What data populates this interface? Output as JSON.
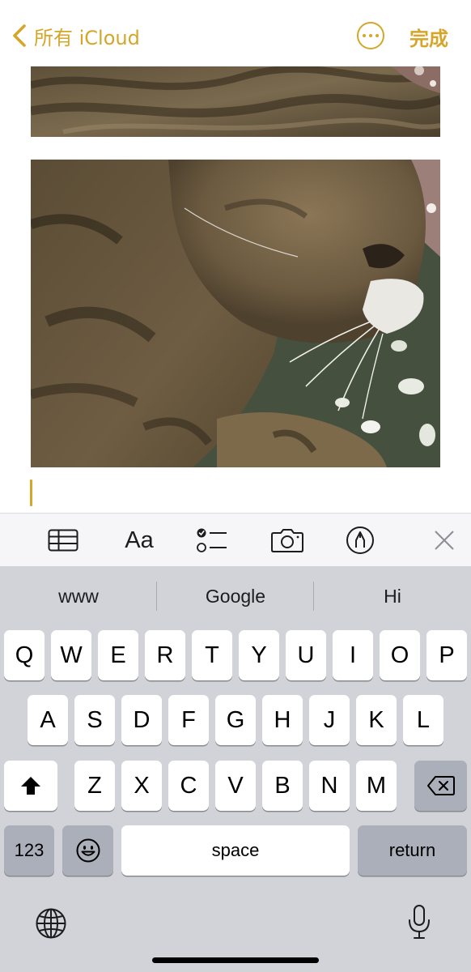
{
  "nav": {
    "back_label": "所有 iCloud",
    "done_label": "完成",
    "accent_color": "#d5a62a"
  },
  "toolbar": {
    "format_label": "Aa",
    "icons": [
      "table-icon",
      "text-format-icon",
      "checklist-icon",
      "camera-icon",
      "markup-pen-icon",
      "close-icon"
    ]
  },
  "keyboard": {
    "suggestions": [
      "www",
      "Google",
      "Hi"
    ],
    "row1": [
      "Q",
      "W",
      "E",
      "R",
      "T",
      "Y",
      "U",
      "I",
      "O",
      "P"
    ],
    "row2": [
      "A",
      "S",
      "D",
      "F",
      "G",
      "H",
      "J",
      "K",
      "L"
    ],
    "row3": [
      "Z",
      "X",
      "C",
      "V",
      "B",
      "N",
      "M"
    ],
    "numbers_label": "123",
    "space_label": "space",
    "return_label": "return",
    "icons": [
      "shift-icon",
      "backspace-icon",
      "emoji-icon",
      "globe-icon",
      "microphone-icon"
    ]
  }
}
